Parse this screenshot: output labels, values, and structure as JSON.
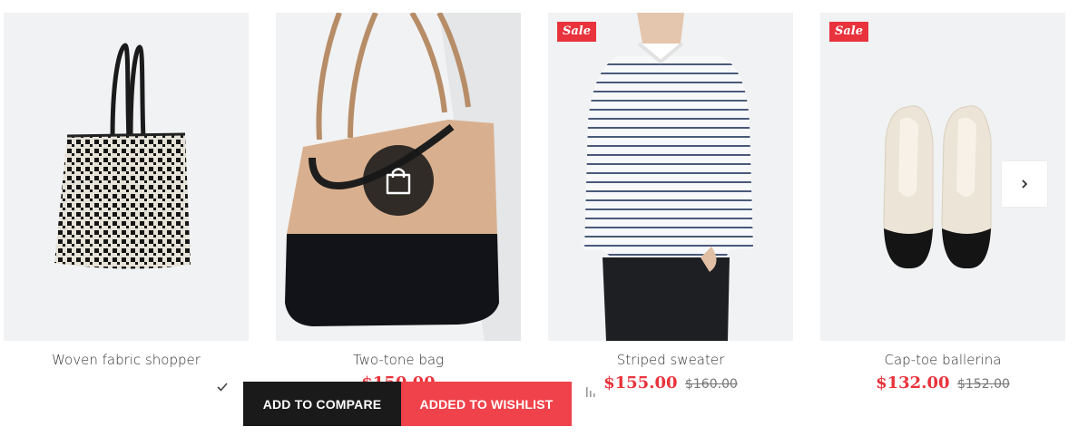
{
  "products": [
    {
      "name": "Woven fabric shopper",
      "price": "",
      "old_price": "",
      "badge": ""
    },
    {
      "name": "Two-tone bag",
      "price": "$150.00",
      "old_price": "",
      "badge": ""
    },
    {
      "name": "Striped sweater",
      "price": "$155.00",
      "old_price": "$160.00",
      "badge": "Sale"
    },
    {
      "name": "Cap-toe ballerina",
      "price": "$132.00",
      "old_price": "$152.00",
      "badge": "Sale"
    }
  ],
  "actions": {
    "compare_label": "ADD TO COMPARE",
    "wishlist_label": "ADDED TO WISHLIST"
  },
  "icons": {
    "quick_add": "shopping-bag-icon",
    "next": "chevron-right-icon",
    "wishlist_state": "check-icon",
    "compare": "bar-chart-icon"
  },
  "colors": {
    "accent": "#e8333c",
    "dark": "#1a1a1a",
    "wishlist_bg": "#f0424a"
  }
}
